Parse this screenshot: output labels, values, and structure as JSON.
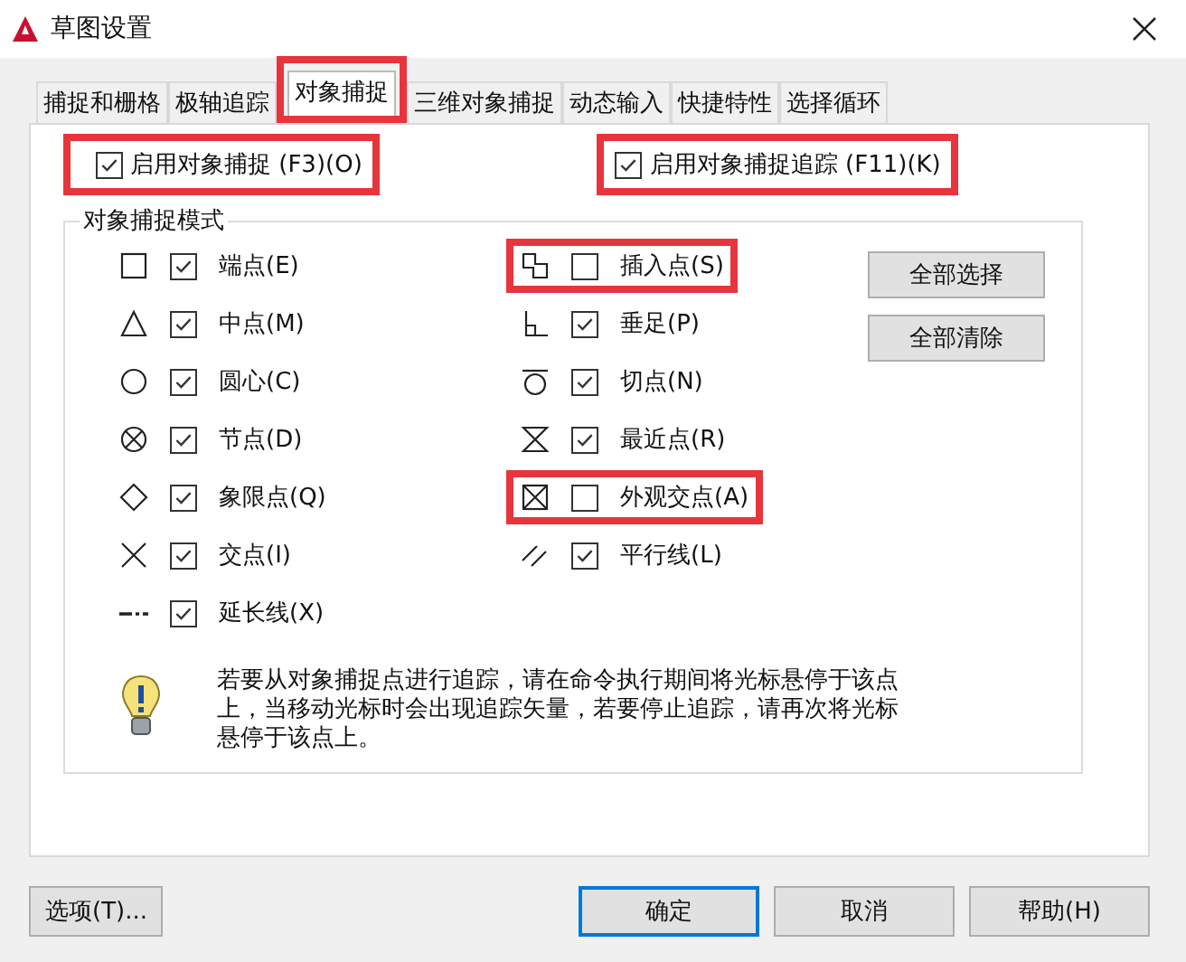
{
  "window": {
    "title": "草图设置"
  },
  "tabs": [
    {
      "label": "捕捉和栅格",
      "selected": false,
      "highlighted": false
    },
    {
      "label": "极轴追踪",
      "selected": false,
      "highlighted": false
    },
    {
      "label": "对象捕捉",
      "selected": true,
      "highlighted": true
    },
    {
      "label": "三维对象捕捉",
      "selected": false,
      "highlighted": false
    },
    {
      "label": "动态输入",
      "selected": false,
      "highlighted": false
    },
    {
      "label": "快捷特性",
      "selected": false,
      "highlighted": false
    },
    {
      "label": "选择循环",
      "selected": false,
      "highlighted": false
    }
  ],
  "enable_options": [
    {
      "label": "启用对象捕捉 (F3)(O)",
      "checked": true,
      "highlighted": true
    },
    {
      "label": "启用对象捕捉追踪 (F11)(K)",
      "checked": true,
      "highlighted": true
    }
  ],
  "snap_modes": {
    "title": "对象捕捉模式",
    "columns": [
      [
        {
          "kind": "square",
          "label": "端点(E)",
          "checked": true,
          "highlighted": false
        },
        {
          "kind": "triangle",
          "label": "中点(M)",
          "checked": true,
          "highlighted": false
        },
        {
          "kind": "circle",
          "label": "圆心(C)",
          "checked": true,
          "highlighted": false
        },
        {
          "kind": "node",
          "label": "节点(D)",
          "checked": true,
          "highlighted": false
        },
        {
          "kind": "diamond",
          "label": "象限点(Q)",
          "checked": true,
          "highlighted": false
        },
        {
          "kind": "cross",
          "label": "交点(I)",
          "checked": true,
          "highlighted": false
        },
        {
          "kind": "extension",
          "label": "延长线(X)",
          "checked": true,
          "highlighted": false
        }
      ],
      [
        {
          "kind": "insertion",
          "label": "插入点(S)",
          "checked": false,
          "highlighted": true
        },
        {
          "kind": "perpendicular",
          "label": "垂足(P)",
          "checked": true,
          "highlighted": false
        },
        {
          "kind": "tangent",
          "label": "切点(N)",
          "checked": true,
          "highlighted": false
        },
        {
          "kind": "nearest",
          "label": "最近点(R)",
          "checked": true,
          "highlighted": false
        },
        {
          "kind": "apparent",
          "label": "外观交点(A)",
          "checked": false,
          "highlighted": true
        },
        {
          "kind": "parallel",
          "label": "平行线(L)",
          "checked": true,
          "highlighted": false
        }
      ]
    ],
    "buttons": [
      "全部选择",
      "全部清除"
    ],
    "tip": "若要从对象捕捉点进行追踪，请在命令执行期间将光标悬停于该点上，当移动光标时会出现追踪矢量，若要停止追踪，请再次将光标悬停于该点上。"
  },
  "footer": {
    "left": "选项(T)...",
    "buttons": [
      {
        "label": "确定",
        "default": true
      },
      {
        "label": "取消",
        "default": false
      },
      {
        "label": "帮助(H)",
        "default": false
      }
    ]
  }
}
